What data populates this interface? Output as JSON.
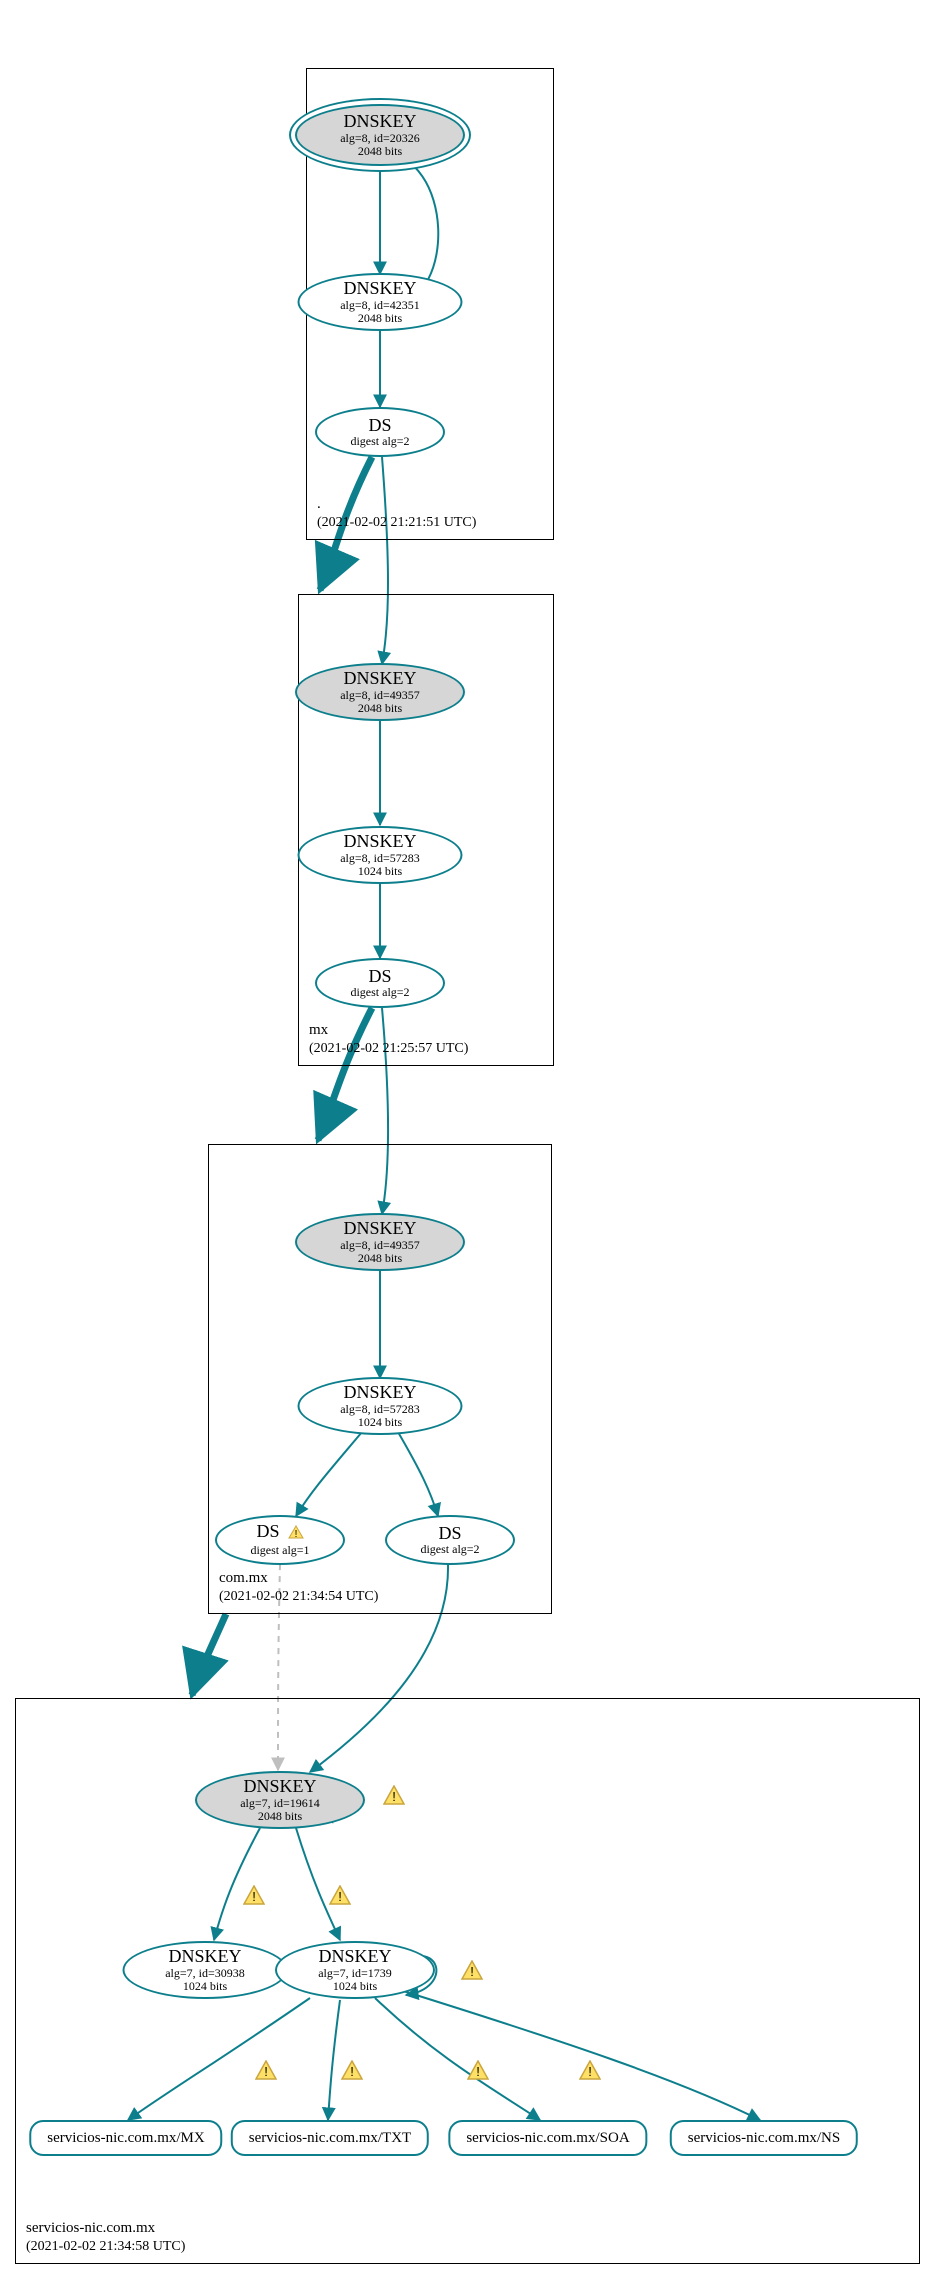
{
  "chart_data": {
    "type": "tree",
    "description": "DNSSEC authentication chain graph",
    "zones": [
      {
        "name": ".",
        "timestamp": "(2021-02-02 21:21:51 UTC)",
        "nodes": [
          {
            "id": "root-ksk",
            "type": "DNSKEY",
            "alg": 8,
            "keyid": 20326,
            "bits": 2048,
            "trust_anchor": true
          },
          {
            "id": "root-zsk",
            "type": "DNSKEY",
            "alg": 8,
            "keyid": 42351,
            "bits": 2048
          },
          {
            "id": "root-ds",
            "type": "DS",
            "digest_alg": 2
          }
        ]
      },
      {
        "name": "mx",
        "timestamp": "(2021-02-02 21:25:57 UTC)",
        "nodes": [
          {
            "id": "mx-ksk",
            "type": "DNSKEY",
            "alg": 8,
            "keyid": 49357,
            "bits": 2048
          },
          {
            "id": "mx-zsk",
            "type": "DNSKEY",
            "alg": 8,
            "keyid": 57283,
            "bits": 1024
          },
          {
            "id": "mx-ds",
            "type": "DS",
            "digest_alg": 2
          }
        ]
      },
      {
        "name": "com.mx",
        "timestamp": "(2021-02-02 21:34:54 UTC)",
        "nodes": [
          {
            "id": "commx-ksk",
            "type": "DNSKEY",
            "alg": 8,
            "keyid": 49357,
            "bits": 2048
          },
          {
            "id": "commx-zsk",
            "type": "DNSKEY",
            "alg": 8,
            "keyid": 57283,
            "bits": 1024
          },
          {
            "id": "commx-ds1",
            "type": "DS",
            "digest_alg": 1,
            "warning": true
          },
          {
            "id": "commx-ds2",
            "type": "DS",
            "digest_alg": 2
          }
        ]
      },
      {
        "name": "servicios-nic.com.mx",
        "timestamp": "(2021-02-02 21:34:58 UTC)",
        "nodes": [
          {
            "id": "sn-ksk",
            "type": "DNSKEY",
            "alg": 7,
            "keyid": 19614,
            "bits": 2048,
            "warning": true
          },
          {
            "id": "sn-zsk1",
            "type": "DNSKEY",
            "alg": 7,
            "keyid": 30938,
            "bits": 1024
          },
          {
            "id": "sn-zsk2",
            "type": "DNSKEY",
            "alg": 7,
            "keyid": 1739,
            "bits": 1024,
            "warning": true
          }
        ],
        "rrsets": [
          {
            "id": "rr-mx",
            "label": "servicios-nic.com.mx/MX",
            "warning": true
          },
          {
            "id": "rr-txt",
            "label": "servicios-nic.com.mx/TXT",
            "warning": true
          },
          {
            "id": "rr-soa",
            "label": "servicios-nic.com.mx/SOA",
            "warning": true
          },
          {
            "id": "rr-ns",
            "label": "servicios-nic.com.mx/NS",
            "warning": true
          }
        ]
      }
    ],
    "edges": [
      {
        "from": "root-ksk",
        "to": "root-ksk",
        "kind": "self"
      },
      {
        "from": "root-ksk",
        "to": "root-zsk"
      },
      {
        "from": "root-zsk",
        "to": "root-ds"
      },
      {
        "from": "root-ds",
        "to": "mx-ksk",
        "delegation": true
      },
      {
        "from": "mx-ksk",
        "to": "mx-ksk",
        "kind": "self"
      },
      {
        "from": "mx-ksk",
        "to": "mx-zsk"
      },
      {
        "from": "mx-zsk",
        "to": "mx-zsk",
        "kind": "self"
      },
      {
        "from": "mx-zsk",
        "to": "mx-ds"
      },
      {
        "from": "mx-ds",
        "to": "commx-ksk",
        "delegation": true
      },
      {
        "from": "commx-ksk",
        "to": "commx-ksk",
        "kind": "self"
      },
      {
        "from": "commx-ksk",
        "to": "commx-zsk"
      },
      {
        "from": "commx-zsk",
        "to": "commx-zsk",
        "kind": "self"
      },
      {
        "from": "commx-zsk",
        "to": "commx-ds1"
      },
      {
        "from": "commx-zsk",
        "to": "commx-ds2"
      },
      {
        "from": "commx-ds1",
        "to": "sn-ksk",
        "style": "dashed-gray"
      },
      {
        "from": "commx-ds2",
        "to": "sn-ksk",
        "delegation": true
      },
      {
        "from": "sn-ksk",
        "to": "sn-ksk",
        "kind": "self",
        "warning": true
      },
      {
        "from": "sn-ksk",
        "to": "sn-zsk1",
        "warning": true
      },
      {
        "from": "sn-ksk",
        "to": "sn-zsk2",
        "warning": true
      },
      {
        "from": "sn-zsk2",
        "to": "sn-zsk2",
        "kind": "self",
        "warning": true
      },
      {
        "from": "sn-zsk2",
        "to": "rr-mx",
        "warning": true
      },
      {
        "from": "sn-zsk2",
        "to": "rr-txt",
        "warning": true
      },
      {
        "from": "sn-zsk2",
        "to": "rr-soa",
        "warning": true
      },
      {
        "from": "sn-zsk2",
        "to": "rr-ns",
        "warning": true
      }
    ]
  },
  "colors": {
    "stroke": "#0d7f8c",
    "fill_key": "#d6d6d6",
    "warn_fill": "#ffe066",
    "warn_stroke": "#caa53d",
    "dashed": "#bfbfbf"
  },
  "labels": {
    "dnskey": "DNSKEY",
    "ds": "DS",
    "alg_prefix": "alg=",
    "id_prefix": ", id=",
    "bits_suffix": " bits",
    "digest_prefix": "digest alg="
  },
  "zones": {
    "root": {
      "name": ".",
      "time": "(2021-02-02 21:21:51 UTC)"
    },
    "mx": {
      "name": "mx",
      "time": "(2021-02-02 21:25:57 UTC)"
    },
    "commx": {
      "name": "com.mx",
      "time": "(2021-02-02 21:34:54 UTC)"
    },
    "sn": {
      "name": "servicios-nic.com.mx",
      "time": "(2021-02-02 21:34:58 UTC)"
    }
  },
  "nodes": {
    "root_ksk": {
      "t": "DNSKEY",
      "l2": "alg=8, id=20326",
      "l3": "2048 bits"
    },
    "root_zsk": {
      "t": "DNSKEY",
      "l2": "alg=8, id=42351",
      "l3": "2048 bits"
    },
    "root_ds": {
      "t": "DS",
      "l2": "digest alg=2"
    },
    "mx_ksk": {
      "t": "DNSKEY",
      "l2": "alg=8, id=49357",
      "l3": "2048 bits"
    },
    "mx_zsk": {
      "t": "DNSKEY",
      "l2": "alg=8, id=57283",
      "l3": "1024 bits"
    },
    "mx_ds": {
      "t": "DS",
      "l2": "digest alg=2"
    },
    "commx_ksk": {
      "t": "DNSKEY",
      "l2": "alg=8, id=49357",
      "l3": "2048 bits"
    },
    "commx_zsk": {
      "t": "DNSKEY",
      "l2": "alg=8, id=57283",
      "l3": "1024 bits"
    },
    "commx_ds1": {
      "t": "DS",
      "l2": "digest alg=1"
    },
    "commx_ds2": {
      "t": "DS",
      "l2": "digest alg=2"
    },
    "sn_ksk": {
      "t": "DNSKEY",
      "l2": "alg=7, id=19614",
      "l3": "2048 bits"
    },
    "sn_zsk1": {
      "t": "DNSKEY",
      "l2": "alg=7, id=30938",
      "l3": "1024 bits"
    },
    "sn_zsk2": {
      "t": "DNSKEY",
      "l2": "alg=7, id=1739",
      "l3": "1024 bits"
    }
  },
  "rrsets": {
    "mx": "servicios-nic.com.mx/MX",
    "txt": "servicios-nic.com.mx/TXT",
    "soa": "servicios-nic.com.mx/SOA",
    "ns": "servicios-nic.com.mx/NS"
  }
}
